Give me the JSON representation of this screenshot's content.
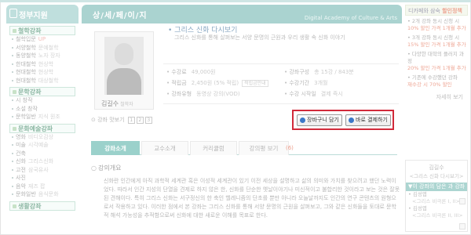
{
  "sidebar": {
    "title": "정부지원",
    "sections": [
      {
        "category": "철학강좌",
        "items": [
          {
            "label": "철학입문",
            "tag": "UP"
          },
          {
            "label": "서양철학",
            "sub": "문예철학"
          },
          {
            "label": "동양철학",
            "sub": "노자 장자"
          },
          {
            "label": "한대철학",
            "sub": "현상학"
          },
          {
            "label": "현대철학",
            "sub": "현상학"
          },
          {
            "label": "현대철학",
            "sub": "대상철학"
          }
        ]
      },
      {
        "category": "문학강좌",
        "items": [
          {
            "label": "시 창작"
          },
          {
            "label": "소설 창작"
          },
          {
            "label": "문학일반",
            "sub": "지식 원조"
          }
        ]
      },
      {
        "category": "문화예술강좌",
        "items": [
          {
            "label": "영화",
            "sub": "비디오감상"
          },
          {
            "label": "미술",
            "sub": "시각예술"
          },
          {
            "label": "건축"
          },
          {
            "label": "신화",
            "sub": "그리스신화"
          },
          {
            "label": "고전",
            "sub": "삼국유사"
          },
          {
            "label": "사진"
          },
          {
            "label": "음악",
            "sub": "재즈 팝"
          },
          {
            "label": "문화일반",
            "sub": "음식문화"
          }
        ]
      },
      {
        "category": "생활강좌",
        "items": []
      }
    ]
  },
  "header": {
    "title": "상/세/페/이/지",
    "subtitle": "Digital Academy of Culture & Arts"
  },
  "instructor": {
    "name": "김길수",
    "role": "철학자"
  },
  "course": {
    "title": "그리스 신화 다시보기",
    "description": "그리스 신화를 통해 살펴보는 서양 문명의 근원과 우리 생활 속 신화 이야기",
    "fee_label": "수강료",
    "fee": "49,000원",
    "points_label": "적립금",
    "points": "2,450원 (5% 적립)",
    "points_tag": "적립금안내",
    "type_label": "강좌유형",
    "type": "동영상 강의(VOD)",
    "structure_label": "강좌구성",
    "structure": "총 15강 / 843분",
    "period_label": "수강기간",
    "period": "3개월",
    "start_label": "수강 시작일",
    "start": "결제 즉시"
  },
  "preview": {
    "label": "강좌 맛보기",
    "pages": [
      "1",
      "2",
      "3"
    ]
  },
  "buttons": {
    "cart": "장바구니 담기",
    "pay": "바로 결제하기"
  },
  "tabs": [
    {
      "label": "강좌소개",
      "active": true
    },
    {
      "label": "교수소개",
      "active": false
    },
    {
      "label": "커리큘럼",
      "active": false
    },
    {
      "label": "강의평 보기",
      "active": false
    }
  ],
  "review_count": "(6)",
  "overview": {
    "title": "강의개요",
    "text": "신화란 인간에게 아직 과학적 세계관 혹은 이성적 세계관이 있기 이전 세상을 설명하고 삶의 의미와 가치를 찾으려고 했던 노력이었다. 따라서 인간 지성의 단열을 견제로 하지 않은 한, 신화를 단순한 옛날이야기나 미신적이고 불합리한 것이라고 보는 것은 잘못된 견해이다. 특히 그리스 신화는 서구정신의 한 축인 헬레니즘의 단초를 뿐만 아니라 오늘날까지도 인간의 연구 콘텐츠의 원형으로서 작용하고 있다. 이러한 점에서 본 강좌는 그리스 신화를 통해 서양 문명의 근원을 살펴보고, 그와 같은 신화들을 토대로 문학적 해석 가능성을 추적함으로써 신화에 대한 새로운 이해를 목표로 한다."
  },
  "right": {
    "promo_prefix": "디카페와 삼숙",
    "promo_highlight": "할인정책",
    "promos": [
      {
        "line1": "• 2개 강좌 동시 신청 시",
        "line2": "10% 할인 가격 1개월 추가"
      },
      {
        "line1": "• 3개 강좌 동시 신청 시",
        "line2": "15% 할인 가격 1개월 추가"
      },
      {
        "line1": "• 다양한 대학의 플러지 과정",
        "line2": "20% 할인 가격 1개월 추가"
      },
      {
        "line1": "• 기존에 수강했던 강좌",
        "line2": "재수강 시 70% 할인"
      }
    ],
    "more": "자세히 보기",
    "cart_name": "김길수",
    "cart_title": "<그리스 신화 다시보기>",
    "history_title": "이 강좌의 담은 과 강좌",
    "history": [
      {
        "name": "• 김성엽",
        "title": "<그리스 비극론 I, II>"
      },
      {
        "name": "• 김성엽",
        "title": "<그리스 비극론 II, III>"
      }
    ]
  }
}
